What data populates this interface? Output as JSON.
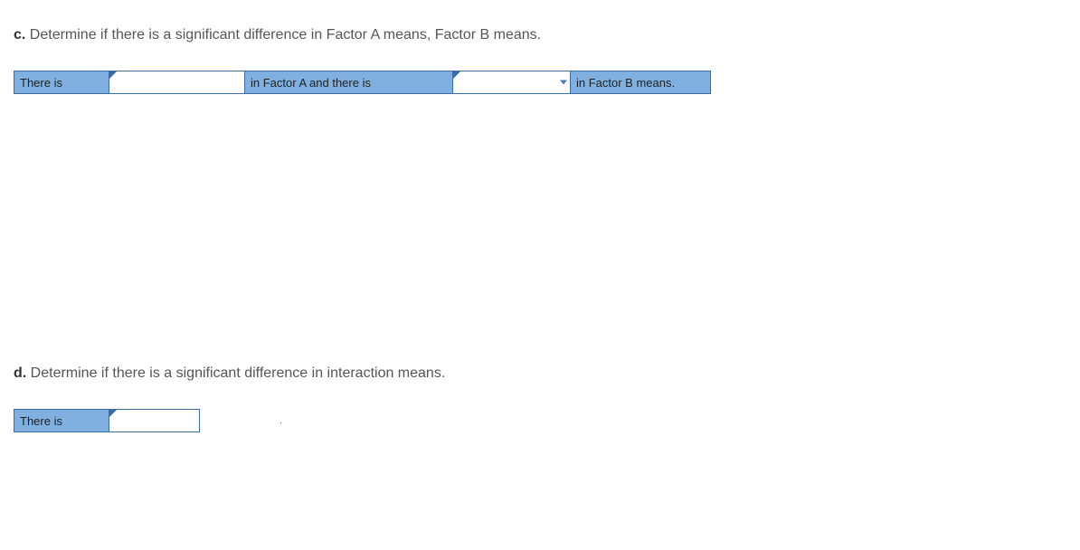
{
  "question_c": {
    "label": "c.",
    "prompt": "Determine if there is a significant difference in Factor A means, Factor B means.",
    "row": {
      "intro": "There is",
      "input1": "",
      "mid": "in Factor A and there is",
      "input2": "",
      "end": "in Factor B means."
    }
  },
  "question_d": {
    "label": "d.",
    "prompt": "Determine if there is a significant difference in interaction means.",
    "row": {
      "intro": "There is",
      "input1": "",
      "period": "."
    }
  }
}
